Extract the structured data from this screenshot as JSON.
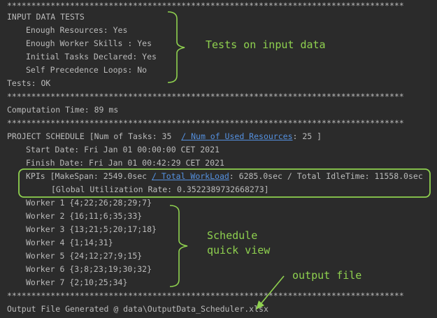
{
  "console": {
    "sep": "**********************************************************************************",
    "input_tests_header": "INPUT DATA TESTS",
    "tests": [
      "Enough Resources: Yes",
      "Enough Worker Skills : Yes",
      "Initial Tasks Declared: Yes",
      "Self Precedence Loops: No"
    ],
    "tests_result": "Tests: OK",
    "computation_time": "Computation Time: 89 ms",
    "schedule_prefix": "PROJECT SCHEDULE [Num of Tasks: 35  ",
    "schedule_link": "/ Num of Used Resources",
    "schedule_suffix": ": 25 ]",
    "start_date": "Start Date: Fri Jan 01 00:00:00 CET 2021",
    "finish_date": "Finish Date: Fri Jan 01 00:42:29 CET 2021",
    "kpi_prefix": "KPIs [MakeSpan: 2549.0sec ",
    "kpi_link": "/ Total WorkLoad",
    "kpi_suffix": ": 6285.0sec / Total IdleTime: 11558.0sec",
    "utilization": "[Global Utilization Rate: 0.3522389732668273]",
    "workers": [
      "Worker 1 {4;22;26;28;29;7}",
      "Worker 2 {16;11;6;35;33}",
      "Worker 3 {13;21;5;20;17;18}",
      "Worker 4 {1;14;31}",
      "Worker 5 {24;12;27;9;15}",
      "Worker 6 {3;8;23;19;30;32}",
      "Worker 7 {2;10;25;34}"
    ],
    "output_file": "Output File Generated @ data\\OutputData_Scheduler.xlsx"
  },
  "annotations": {
    "tests_note": "Tests on input data",
    "schedule_note_line1": "Schedule",
    "schedule_note_line2": "quick view",
    "output_note": "output file",
    "color": "#8fd14f"
  }
}
